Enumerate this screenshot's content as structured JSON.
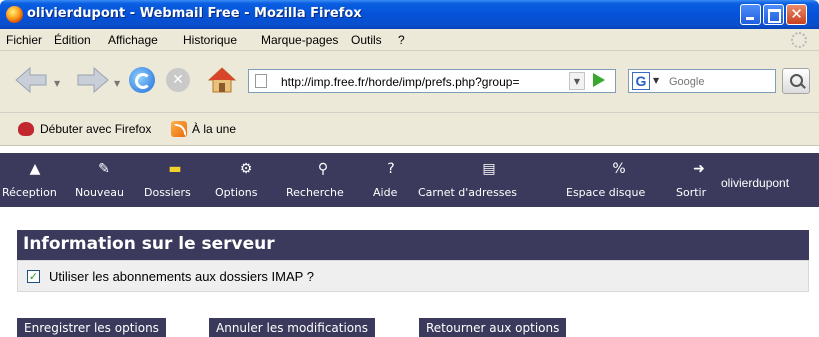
{
  "window": {
    "title": "olivierdupont - Webmail Free - Mozilla Firefox",
    "minimize_glyph": "",
    "close_glyph": "✕"
  },
  "menubar": {
    "items": [
      "Fichier",
      "Édition",
      "Affichage",
      "Historique",
      "Marque-pages",
      "Outils",
      "?"
    ]
  },
  "navbar": {
    "url": "http://imp.free.fr/horde/imp/prefs.php?group=",
    "search_placeholder": "Google",
    "search_engine_letter": "G",
    "stop_glyph": "✕"
  },
  "bookmarks": {
    "items": [
      "Débuter avec Firefox",
      "À la une"
    ]
  },
  "webmail": {
    "nav": [
      {
        "label": "Réception",
        "icon": "inbox-icon",
        "glyph": "▲"
      },
      {
        "label": "Nouveau",
        "icon": "compose-icon",
        "glyph": "✎"
      },
      {
        "label": "Dossiers",
        "icon": "folders-icon",
        "glyph": "▬"
      },
      {
        "label": "Options",
        "icon": "options-icon",
        "glyph": "⚙"
      },
      {
        "label": "Recherche",
        "icon": "search-icon",
        "glyph": "⚲"
      },
      {
        "label": "Aide",
        "icon": "help-icon",
        "glyph": "?"
      },
      {
        "label": "Carnet d'adresses",
        "icon": "address-book-icon",
        "glyph": "▤"
      },
      {
        "label": "Espace disque",
        "icon": "disk-space-icon",
        "glyph": "%"
      },
      {
        "label": "Sortir",
        "icon": "logout-icon",
        "glyph": "➜"
      }
    ],
    "username": "olivierdupont",
    "section_title": "Information sur le serveur",
    "option": {
      "label": "Utiliser les abonnements aux dossiers IMAP ?",
      "checked": true,
      "check_glyph": "✓"
    },
    "buttons": {
      "save": "Enregistrer les options",
      "cancel": "Annuler les modifications",
      "back": "Retourner aux options"
    }
  }
}
